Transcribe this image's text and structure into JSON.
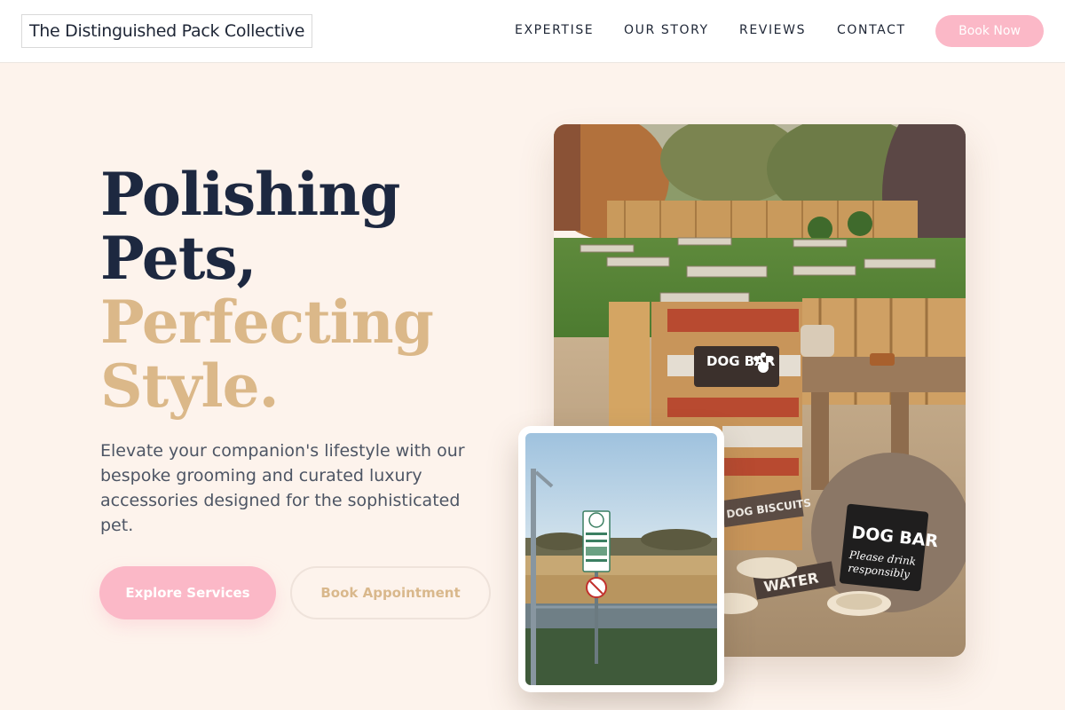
{
  "header": {
    "brand": "The Distinguished Pack Collective",
    "nav": [
      "EXPERTISE",
      "OUR STORY",
      "REVIEWS",
      "CONTACT"
    ],
    "cta": "Book Now"
  },
  "hero": {
    "headline_dark_1": "Polishing",
    "headline_dark_2": "Pets,",
    "headline_gold_1": "Perfecting",
    "headline_gold_2": "Style.",
    "lead": "Elevate your companion's lifestyle with our bespoke grooming and curated luxury accessories designed for the sophisticated pet.",
    "primary_button": "Explore Services",
    "secondary_button": "Book Appointment"
  },
  "photos": {
    "main": {
      "sign_top": "DOG BAR",
      "sign_board": "DOG BAR",
      "sign_board_note_1": "Please drink",
      "sign_board_note_2": "responsibly",
      "biscuits": "DOG BISCUITS",
      "water": "WATER"
    }
  },
  "colors": {
    "background": "#fdf3ec",
    "navy": "#1d2840",
    "gold": "#dbb889",
    "pink": "#fbb8c7"
  }
}
